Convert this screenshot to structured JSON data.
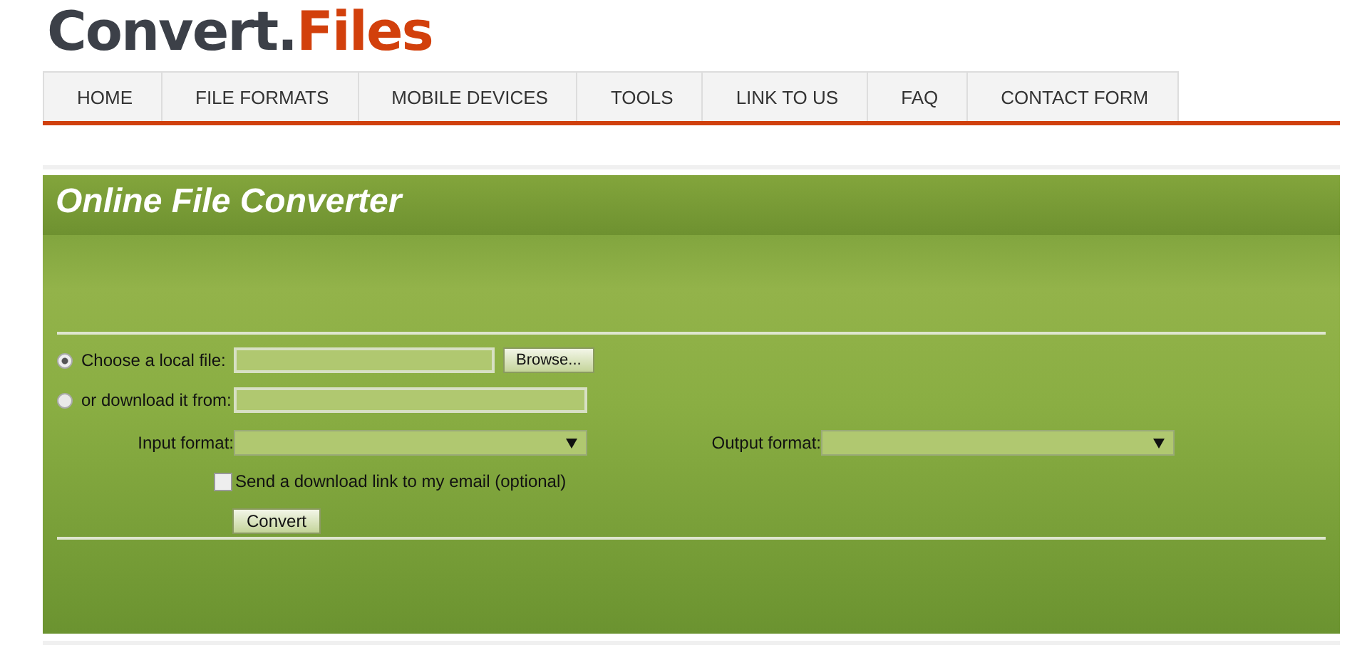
{
  "logo": {
    "part_1": "Convert.",
    "part_2": "Files"
  },
  "nav": [
    {
      "label": "HOME"
    },
    {
      "label": "FILE FORMATS"
    },
    {
      "label": "MOBILE DEVICES"
    },
    {
      "label": "TOOLS"
    },
    {
      "label": "LINK TO US"
    },
    {
      "label": "FAQ"
    },
    {
      "label": "CONTACT FORM"
    }
  ],
  "panel": {
    "title": "Online File Converter",
    "sources": [
      {
        "label": "Choose a local file:",
        "selected": true,
        "button": "Browse..."
      },
      {
        "label": "or download it from:",
        "selected": false
      }
    ],
    "input_format": {
      "label": "Input format:"
    },
    "output_format": {
      "label": "Output format:"
    },
    "email_option": {
      "label": "Send a download link to my email (optional)",
      "checked": false
    },
    "submit": "Convert"
  }
}
